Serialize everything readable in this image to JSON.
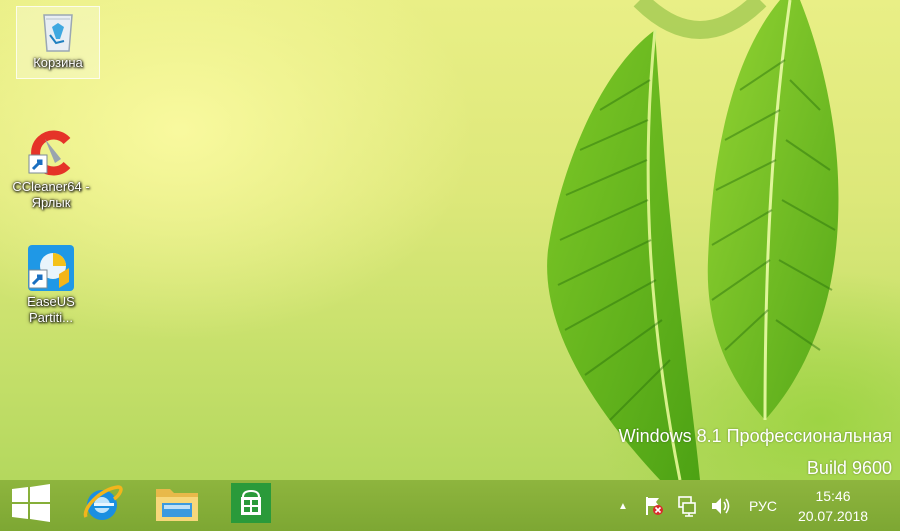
{
  "desktop": {
    "icons": [
      {
        "label": "Корзина",
        "icon": "recycle-bin-icon"
      },
      {
        "label": "CCleaner64 - Ярлык",
        "icon": "ccleaner-icon"
      },
      {
        "label": "EaseUS Partiti...",
        "icon": "easeus-partition-icon"
      }
    ],
    "watermark": {
      "line1": "Windows 8.1 Профессиональная",
      "line2": "Build 9600"
    }
  },
  "taskbar": {
    "pinned": [
      {
        "name": "start",
        "icon": "windows-logo-icon"
      },
      {
        "name": "internet-explorer",
        "icon": "internet-explorer-icon"
      },
      {
        "name": "file-explorer",
        "icon": "file-explorer-icon"
      },
      {
        "name": "store",
        "icon": "store-icon"
      }
    ],
    "tray": {
      "show_hidden": "▲",
      "language": "РУС",
      "time": "15:46",
      "date": "20.07.2018"
    }
  },
  "colors": {
    "taskbar": "#7da733",
    "store_tile": "#2a9a3a",
    "ie_blue": "#1a8fe0"
  }
}
